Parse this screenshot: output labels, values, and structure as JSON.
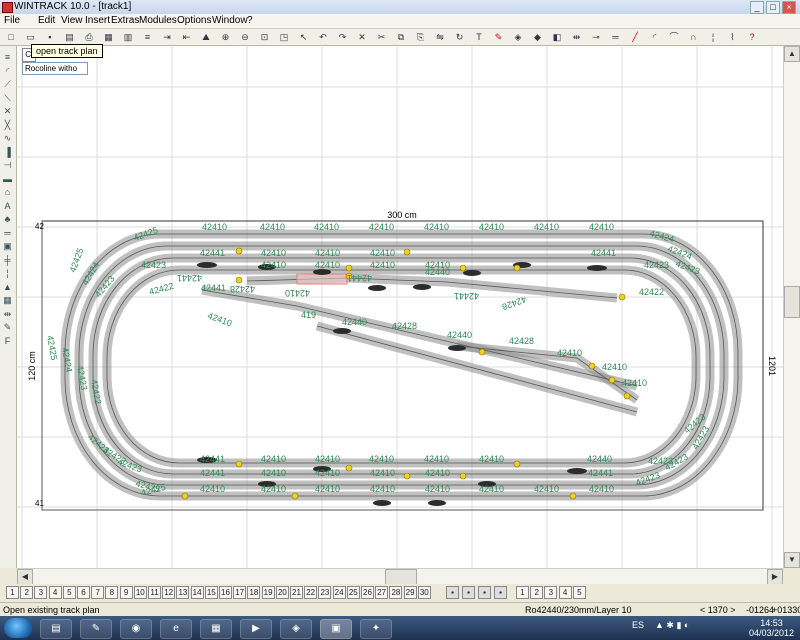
{
  "window": {
    "title": "WINTRACK 10.0 - [track1]",
    "min": "_",
    "max": "□",
    "close": "×"
  },
  "menu": [
    "File",
    "Edit",
    "View",
    "Insert",
    "Extras",
    "Modules",
    "Options",
    "Window",
    "?"
  ],
  "tooltip": "open track plan",
  "layer_button": "Cl",
  "layer_select": "Rocoline witho",
  "plan": {
    "width_label": "300 cm",
    "height_left": "120 cm",
    "height_right": "1201",
    "corner_top": "42",
    "corner_bottom": "41"
  },
  "track_labels": [
    {
      "t": "42410",
      "a": 0
    },
    {
      "t": "42410",
      "a": 0
    },
    {
      "t": "42410",
      "a": 0
    },
    {
      "t": "42410",
      "a": 0
    },
    {
      "t": "42410",
      "a": 0
    },
    {
      "t": "42410",
      "a": 0
    },
    {
      "t": "42410",
      "a": 0
    },
    {
      "t": "42410",
      "a": 0
    },
    {
      "t": "42425",
      "a": -20
    },
    {
      "t": "42424",
      "a": 15
    },
    {
      "t": "42424",
      "a": 20
    },
    {
      "t": "42423",
      "a": 20
    },
    {
      "t": "42441",
      "a": 0
    },
    {
      "t": "42410",
      "a": 0
    },
    {
      "t": "42410",
      "a": 0
    },
    {
      "t": "42410",
      "a": 0
    },
    {
      "t": "42441",
      "a": 0
    },
    {
      "t": "42423",
      "a": 0
    },
    {
      "t": "42410",
      "a": 0
    },
    {
      "t": "42410",
      "a": 0
    },
    {
      "t": "42410",
      "a": 0
    },
    {
      "t": "42410",
      "a": 0
    },
    {
      "t": "42423",
      "a": 0
    },
    {
      "t": "42441",
      "a": 180
    },
    {
      "t": "42428",
      "a": 180
    },
    {
      "t": "42410",
      "a": 180
    },
    {
      "t": "42441",
      "a": 180
    },
    {
      "t": "42440",
      "a": 0
    },
    {
      "t": "42441",
      "a": 180
    },
    {
      "t": "42422",
      "a": -15
    },
    {
      "t": "42441",
      "a": 0
    },
    {
      "t": "42422",
      "a": 0
    },
    {
      "t": "42410",
      "a": 20
    },
    {
      "t": "419",
      "a": 0
    },
    {
      "t": "42440",
      "a": 0
    },
    {
      "t": "42428",
      "a": 0
    },
    {
      "t": "42428",
      "a": 160
    },
    {
      "t": "42440",
      "a": 0
    },
    {
      "t": "42428",
      "a": 0
    },
    {
      "t": "42410",
      "a": 0
    },
    {
      "t": "42410",
      "a": 0
    },
    {
      "t": "42410",
      "a": 0
    },
    {
      "t": "42425",
      "a": -70
    },
    {
      "t": "42424",
      "a": -60
    },
    {
      "t": "42423",
      "a": -50
    },
    {
      "t": "42425",
      "a": 80
    },
    {
      "t": "42424",
      "a": 80
    },
    {
      "t": "42423",
      "a": 80
    },
    {
      "t": "42422",
      "a": 80
    },
    {
      "t": "42423",
      "a": 40
    },
    {
      "t": "42423",
      "a": 30
    },
    {
      "t": "42423",
      "a": 20
    },
    {
      "t": "42425",
      "a": 15
    },
    {
      "t": "42441",
      "a": 0
    },
    {
      "t": "42410",
      "a": 0
    },
    {
      "t": "42410",
      "a": 0
    },
    {
      "t": "42410",
      "a": 0
    },
    {
      "t": "42410",
      "a": 0
    },
    {
      "t": "42410",
      "a": 0
    },
    {
      "t": "42440",
      "a": 0
    },
    {
      "t": "42423",
      "a": 0
    },
    {
      "t": "42441",
      "a": 0
    },
    {
      "t": "42410",
      "a": 0
    },
    {
      "t": "42410",
      "a": 0
    },
    {
      "t": "42410",
      "a": 0
    },
    {
      "t": "42410",
      "a": 0
    },
    {
      "t": "42441",
      "a": 0
    },
    {
      "t": "42423",
      "a": -20
    },
    {
      "t": "42410",
      "a": 0
    },
    {
      "t": "42410",
      "a": 0
    },
    {
      "t": "42410",
      "a": 0
    },
    {
      "t": "42410",
      "a": 0
    },
    {
      "t": "42410",
      "a": 0
    },
    {
      "t": "42410",
      "a": 0
    },
    {
      "t": "42410",
      "a": 0
    },
    {
      "t": "42410",
      "a": 0
    },
    {
      "t": "42425",
      "a": -15
    },
    {
      "t": "42423",
      "a": -40
    },
    {
      "t": "42423",
      "a": -60
    },
    {
      "t": "42423",
      "a": -30
    }
  ],
  "layer_tabs": [
    "1",
    "2",
    "3",
    "4",
    "5",
    "6",
    "7",
    "8",
    "9",
    "10",
    "11",
    "12",
    "13",
    "14",
    "15",
    "16",
    "17",
    "18",
    "19",
    "20",
    "21",
    "22",
    "23",
    "24",
    "25",
    "26",
    "27",
    "28",
    "29",
    "30"
  ],
  "layer_tabs_right": [
    "1",
    "2",
    "3",
    "4",
    "5"
  ],
  "status": {
    "left": "Open existing track plan",
    "middle": "Ro42440/230mm/Layer 10",
    "coord1": "< 1370 >",
    "coord2": "-01264",
    "coord3": "+01330"
  },
  "taskbar": {
    "lang": "ES",
    "time": "14:53",
    "date": "04/03/2012"
  },
  "colors": {
    "track_label": "#2e8b57",
    "track": "#c8c8c8",
    "grid": "#d9d9d9",
    "accent": "#c00"
  },
  "icons": [
    "new-icon",
    "open-icon",
    "save-icon",
    "print-icon",
    "zoom-in-icon",
    "zoom-out-icon",
    "undo-icon",
    "redo-icon",
    "cut-icon",
    "copy-icon",
    "paste-icon",
    "help-icon"
  ]
}
